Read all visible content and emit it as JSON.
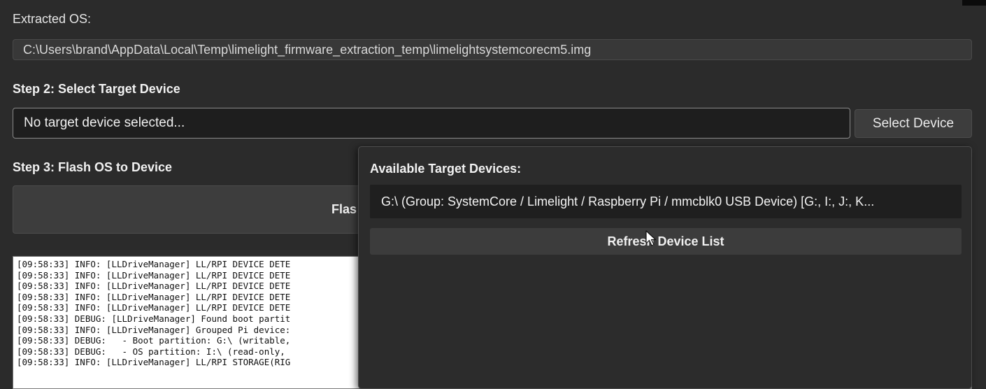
{
  "extracted_os": {
    "label": "Extracted OS:",
    "path": "C:\\Users\\brand\\AppData\\Local\\Temp\\limelight_firmware_extraction_temp\\limelightsystemcorecm5.img"
  },
  "step2": {
    "title": "Step 2: Select Target Device",
    "field_value": "No target device selected...",
    "select_button": "Select Device"
  },
  "step3": {
    "title": "Step 3: Flash OS to Device",
    "flash_button_visible": "Flas"
  },
  "log": {
    "lines": [
      "[09:58:33] INFO: [LLDriveManager] LL/RPI DEVICE DETE",
      "[09:58:33] INFO: [LLDriveManager] LL/RPI DEVICE DETE",
      "[09:58:33] INFO: [LLDriveManager] LL/RPI DEVICE DETE",
      "[09:58:33] INFO: [LLDriveManager] LL/RPI DEVICE DETE",
      "[09:58:33] INFO: [LLDriveManager] LL/RPI DEVICE DETE",
      "[09:58:33] DEBUG: [LLDriveManager] Found boot partit",
      "[09:58:33] INFO: [LLDriveManager] Grouped Pi device:",
      "[09:58:33] DEBUG:   - Boot partition: G:\\ (writable,",
      "[09:58:33] DEBUG:   - OS partition: I:\\ (read-only,",
      "[09:58:33] INFO: [LLDriveManager] LL/RPI STORAGE(RIG"
    ]
  },
  "popup": {
    "title": "Available Target Devices:",
    "devices": [
      "G:\\ (Group: SystemCore / Limelight / Raspberry Pi / mmcblk0 USB Device) [G:, I:, J:, K..."
    ],
    "refresh_button": "Refresh Device List"
  },
  "colors": {
    "background": "#2b2b2b",
    "field_dark": "#1e1e1e",
    "button": "#3d3d3d",
    "log_background": "#ffffff"
  }
}
